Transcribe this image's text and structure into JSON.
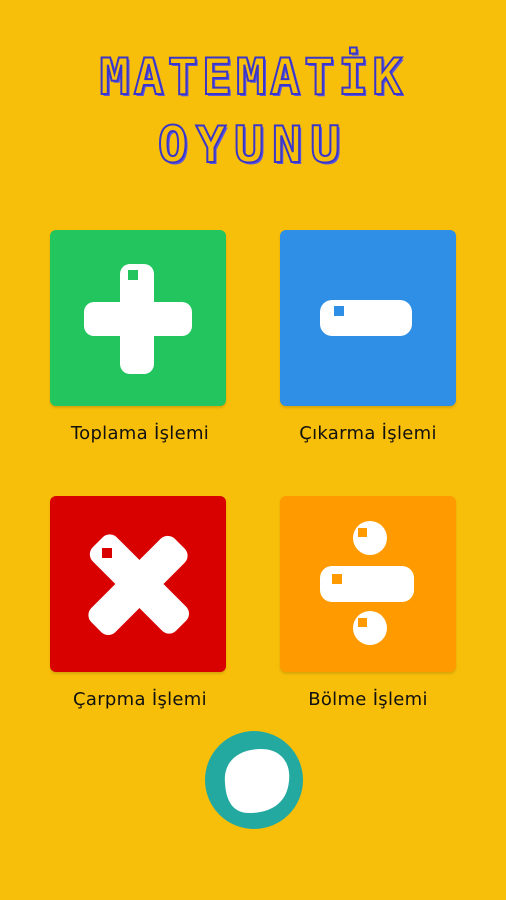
{
  "title": {
    "line1": "MATEMATİK",
    "line2": "OYUNU"
  },
  "colors": {
    "background": "#F7BE0A",
    "addition": "#22C55E",
    "subtraction": "#2F8FE6",
    "multiplication": "#D90000",
    "division": "#FF9A00",
    "play_button": "#23A9A0"
  },
  "operations": [
    {
      "label": "Toplama İşlemi",
      "icon": "plus-icon"
    },
    {
      "label": "Çıkarma İşlemi",
      "icon": "minus-icon"
    },
    {
      "label": "Çarpma İşlemi",
      "icon": "times-icon"
    },
    {
      "label": "Bölme İşlemi",
      "icon": "divide-icon"
    }
  ],
  "play_button": {
    "icon": "play-blob-icon"
  }
}
